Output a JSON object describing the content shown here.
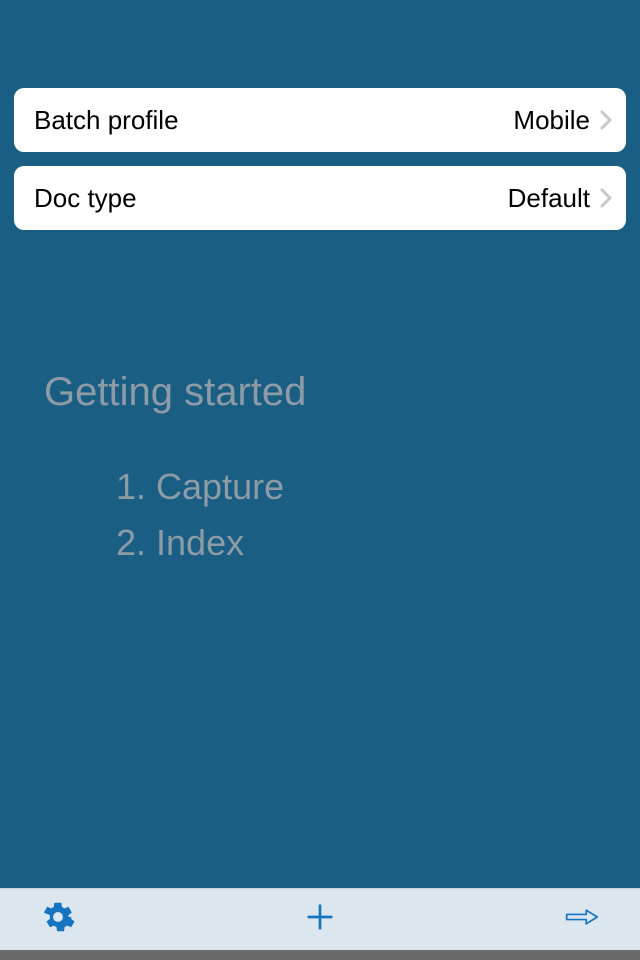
{
  "rows": {
    "batch_profile": {
      "label": "Batch profile",
      "value": "Mobile"
    },
    "doc_type": {
      "label": "Doc type",
      "value": "Default"
    }
  },
  "getting_started": {
    "title": "Getting started",
    "step1": "1. Capture",
    "step2": "2. Index"
  },
  "icons": {
    "settings": "gear-icon",
    "add": "plus-icon",
    "next": "arrow-right-icon"
  },
  "colors": {
    "background": "#1a5e83",
    "toolbar": "#dbe6ee",
    "accent": "#1674c1",
    "muted": "#8d9ba6"
  }
}
